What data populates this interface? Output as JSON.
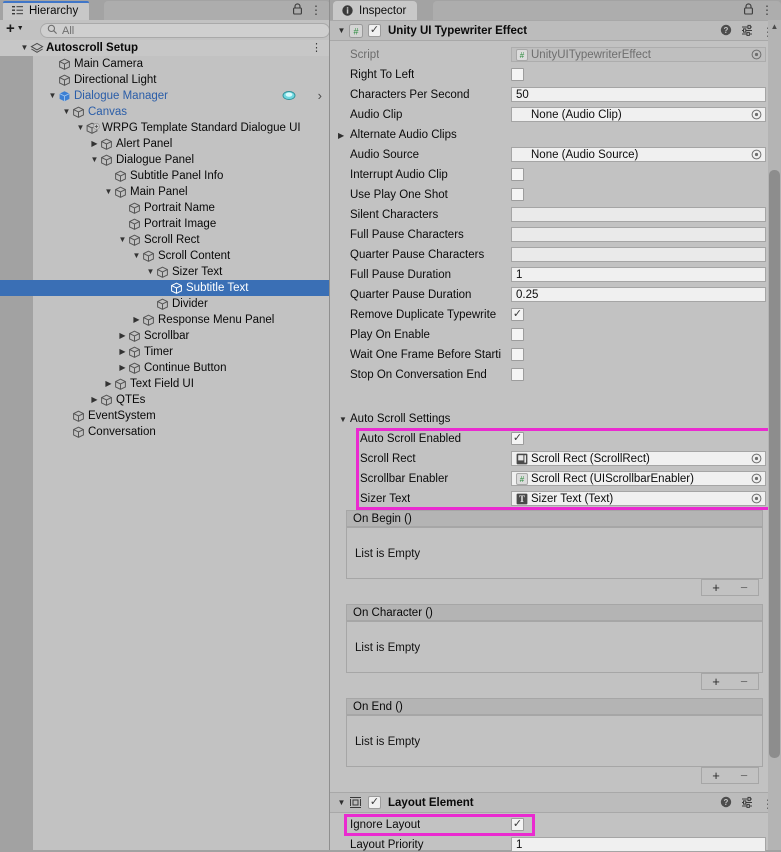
{
  "hierarchy": {
    "tab_label": "Hierarchy",
    "tab_icon": "hierarchy-icon",
    "create_label": "+",
    "search": {
      "placeholder": "All",
      "value": "",
      "icon": "search-icon"
    },
    "lock_icon": "lock-icon",
    "menu_icon": "kebab-menu-icon",
    "items": [
      {
        "label": "Autoscroll Setup",
        "depth": 0,
        "twirl": "down",
        "icon": "scene-icon",
        "bold": true,
        "prefab": false,
        "selected": false,
        "row_menu": true
      },
      {
        "label": "Main Camera",
        "depth": 2,
        "twirl": "none",
        "icon": "gameobject-icon",
        "bold": false,
        "prefab": false,
        "selected": false
      },
      {
        "label": "Directional Light",
        "depth": 2,
        "twirl": "none",
        "icon": "gameobject-icon",
        "bold": false,
        "prefab": false,
        "selected": false
      },
      {
        "label": "Dialogue Manager",
        "depth": 2,
        "twirl": "down",
        "icon": "prefab-icon",
        "bold": false,
        "prefab": true,
        "selected": false,
        "visibility_chip": true,
        "row_arrow": true
      },
      {
        "label": "Canvas",
        "depth": 3,
        "twirl": "down",
        "icon": "gameobject-icon",
        "bold": false,
        "prefab": true,
        "selected": false
      },
      {
        "label": "WRPG Template Standard Dialogue UI",
        "depth": 4,
        "twirl": "down",
        "icon": "prefab-add-icon",
        "bold": false,
        "prefab": false,
        "selected": false
      },
      {
        "label": "Alert Panel",
        "depth": 5,
        "twirl": "right",
        "icon": "gameobject-icon",
        "bold": false,
        "prefab": false,
        "selected": false
      },
      {
        "label": "Dialogue Panel",
        "depth": 5,
        "twirl": "down",
        "icon": "gameobject-icon",
        "bold": false,
        "prefab": false,
        "selected": false
      },
      {
        "label": "Subtitle Panel Info",
        "depth": 6,
        "twirl": "none",
        "icon": "gameobject-icon",
        "bold": false,
        "prefab": false,
        "selected": false
      },
      {
        "label": "Main Panel",
        "depth": 6,
        "twirl": "down",
        "icon": "gameobject-icon",
        "bold": false,
        "prefab": false,
        "selected": false
      },
      {
        "label": "Portrait Name",
        "depth": 7,
        "twirl": "none",
        "icon": "gameobject-icon",
        "bold": false,
        "prefab": false,
        "selected": false
      },
      {
        "label": "Portrait Image",
        "depth": 7,
        "twirl": "none",
        "icon": "gameobject-icon",
        "bold": false,
        "prefab": false,
        "selected": false
      },
      {
        "label": "Scroll Rect",
        "depth": 7,
        "twirl": "down",
        "icon": "gameobject-icon",
        "bold": false,
        "prefab": false,
        "selected": false
      },
      {
        "label": "Scroll Content",
        "depth": 8,
        "twirl": "down",
        "icon": "gameobject-icon",
        "bold": false,
        "prefab": false,
        "selected": false
      },
      {
        "label": "Sizer Text",
        "depth": 9,
        "twirl": "down",
        "icon": "gameobject-icon",
        "bold": false,
        "prefab": false,
        "selected": false
      },
      {
        "label": "Subtitle Text",
        "depth": 10,
        "twirl": "none",
        "icon": "gameobject-icon",
        "bold": false,
        "prefab": false,
        "selected": true
      },
      {
        "label": "Divider",
        "depth": 9,
        "twirl": "none",
        "icon": "gameobject-icon",
        "bold": false,
        "prefab": false,
        "selected": false
      },
      {
        "label": "Response Menu Panel",
        "depth": 8,
        "twirl": "right",
        "icon": "gameobject-icon",
        "bold": false,
        "prefab": false,
        "selected": false
      },
      {
        "label": "Scrollbar",
        "depth": 7,
        "twirl": "right",
        "icon": "gameobject-icon",
        "bold": false,
        "prefab": false,
        "selected": false
      },
      {
        "label": "Timer",
        "depth": 7,
        "twirl": "right",
        "icon": "gameobject-icon",
        "bold": false,
        "prefab": false,
        "selected": false
      },
      {
        "label": "Continue Button",
        "depth": 7,
        "twirl": "right",
        "icon": "gameobject-icon",
        "bold": false,
        "prefab": false,
        "selected": false
      },
      {
        "label": "Text Field UI",
        "depth": 6,
        "twirl": "right",
        "icon": "gameobject-icon",
        "bold": false,
        "prefab": false,
        "selected": false
      },
      {
        "label": "QTEs",
        "depth": 5,
        "twirl": "right",
        "icon": "gameobject-icon",
        "bold": false,
        "prefab": false,
        "selected": false
      },
      {
        "label": "EventSystem",
        "depth": 3,
        "twirl": "none",
        "icon": "gameobject-icon",
        "bold": false,
        "prefab": false,
        "selected": false
      },
      {
        "label": "Conversation",
        "depth": 3,
        "twirl": "none",
        "icon": "gameobject-icon",
        "bold": false,
        "prefab": false,
        "selected": false
      }
    ]
  },
  "inspector": {
    "tab_label": "Inspector",
    "tab_icon": "info-icon",
    "lock_icon": "lock-icon",
    "menu_icon": "kebab-menu-icon",
    "scrollbar": {
      "up_arrow": "▲"
    },
    "component": {
      "name": "Unity UI Typewriter Effect",
      "enabled": true,
      "foldout": "down",
      "icon": "cs-script-icon",
      "help_icon": "help-icon",
      "preset_icon": "preset-icon",
      "menu_icon": "kebab-menu-icon"
    },
    "fields": [
      {
        "label": "Script",
        "type": "object",
        "value": "UnityUITypewriterEffect",
        "icon": "cs-script-icon",
        "disabled": true
      },
      {
        "label": "Right To Left",
        "type": "checkbox",
        "value": false
      },
      {
        "label": "Characters Per Second",
        "type": "text",
        "value": "50"
      },
      {
        "label": "Audio Clip",
        "type": "object",
        "value": "None (Audio Clip)",
        "icon": "none-icon"
      },
      {
        "label": "Alternate Audio Clips",
        "type": "foldout",
        "foldout": "right"
      },
      {
        "label": "Audio Source",
        "type": "object",
        "value": "None (Audio Source)",
        "icon": "none-icon"
      },
      {
        "label": "Interrupt Audio Clip",
        "type": "checkbox",
        "value": false
      },
      {
        "label": "Use Play One Shot",
        "type": "checkbox",
        "value": false
      },
      {
        "label": "Silent Characters",
        "type": "text",
        "value": ""
      },
      {
        "label": "Full Pause Characters",
        "type": "text",
        "value": ""
      },
      {
        "label": "Quarter Pause Characters",
        "type": "text",
        "value": ""
      },
      {
        "label": "Full Pause Duration",
        "type": "text",
        "value": "1"
      },
      {
        "label": "Quarter Pause Duration",
        "type": "text",
        "value": "0.25"
      },
      {
        "label": "Remove Duplicate Typewrite",
        "type": "checkbox",
        "value": true
      },
      {
        "label": "Play On Enable",
        "type": "checkbox",
        "value": false
      },
      {
        "label": "Wait One Frame Before Starti",
        "type": "checkbox",
        "value": false
      },
      {
        "label": "Stop On Conversation End",
        "type": "checkbox",
        "value": false
      }
    ],
    "auto_scroll": {
      "header": "Auto Scroll Settings",
      "foldout": "down",
      "highlighted": true,
      "fields": [
        {
          "label": "Auto Scroll Enabled",
          "type": "checkbox",
          "value": true
        },
        {
          "label": "Scroll Rect",
          "type": "object",
          "value": "Scroll Rect (ScrollRect)",
          "icon": "scrollrect-icon"
        },
        {
          "label": "Scrollbar Enabler",
          "type": "object",
          "value": "Scroll Rect (UIScrollbarEnabler)",
          "icon": "cs-script-icon"
        },
        {
          "label": "Sizer Text",
          "type": "object",
          "value": "Sizer Text (Text)",
          "icon": "text-icon"
        }
      ]
    },
    "events": [
      {
        "title": "On Begin ()",
        "empty_text": "List is Empty",
        "add_label": "+",
        "remove_label": "−"
      },
      {
        "title": "On Character ()",
        "empty_text": "List is Empty",
        "add_label": "+",
        "remove_label": "−"
      },
      {
        "title": "On End ()",
        "empty_text": "List is Empty",
        "add_label": "+",
        "remove_label": "−"
      }
    ],
    "layout_element": {
      "name": "Layout Element",
      "enabled": true,
      "foldout": "down",
      "icon": "layout-element-icon",
      "help_icon": "help-icon",
      "preset_icon": "preset-icon",
      "menu_icon": "kebab-menu-icon",
      "fields": [
        {
          "label": "Ignore Layout",
          "type": "checkbox",
          "value": true,
          "highlighted": true
        },
        {
          "label": "Layout Priority",
          "type": "text",
          "value": "1"
        }
      ]
    }
  },
  "colors": {
    "highlight": "#ea2ad0",
    "selection": "#3a6fb5",
    "prefab_blue": "#2a5da8",
    "panel_bg": "#c2c2c2",
    "window_bg": "#a2a2a2"
  }
}
